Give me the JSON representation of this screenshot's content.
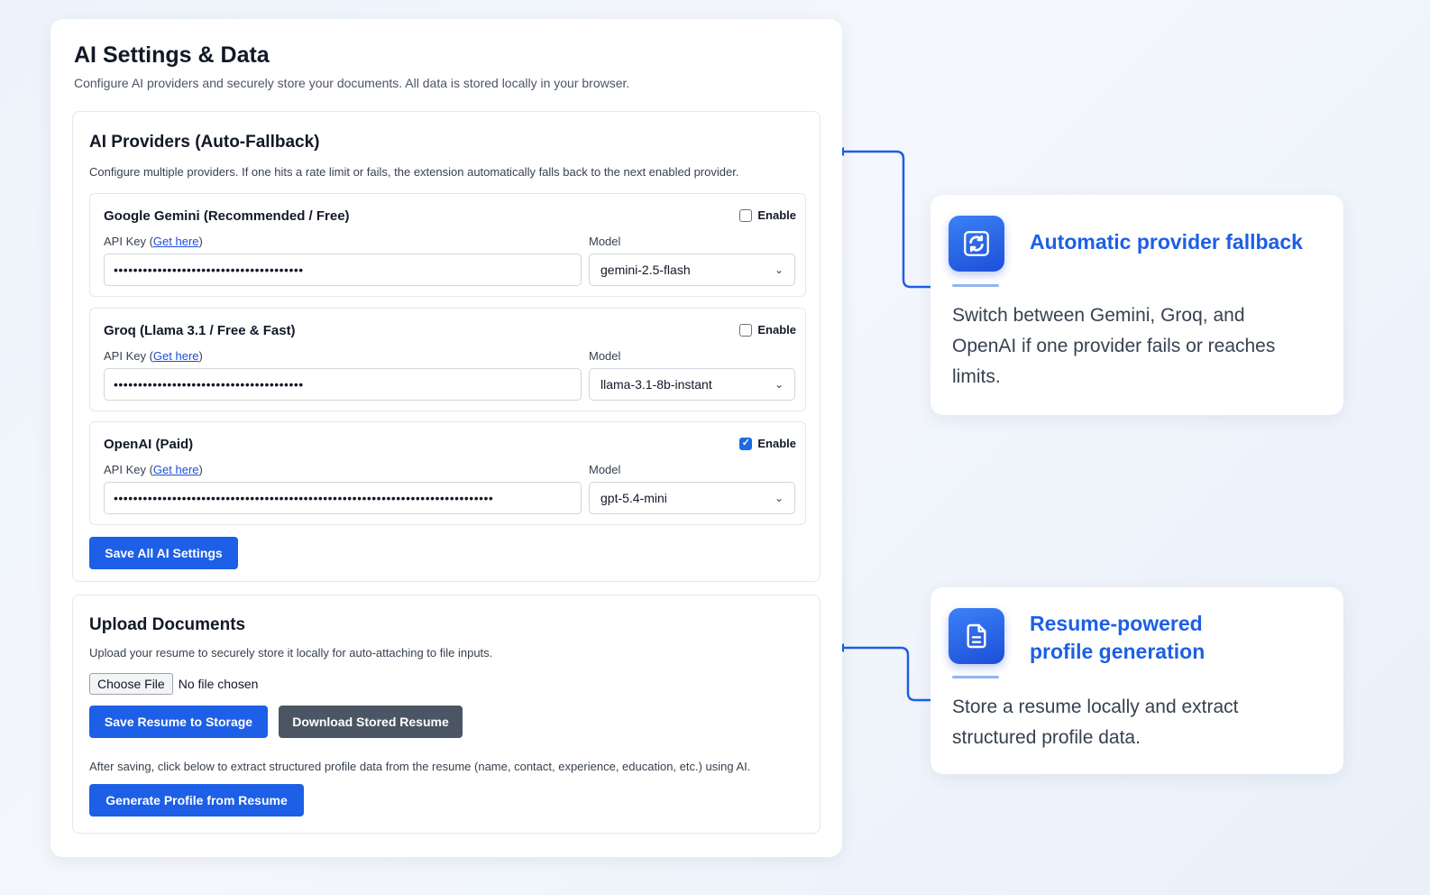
{
  "page": {
    "title": "AI Settings & Data",
    "subtitle": "Configure AI providers and securely store your documents. All data is stored locally in your browser."
  },
  "providers_section": {
    "title": "AI Providers (Auto-Fallback)",
    "description": "Configure multiple providers. If one hits a rate limit or fails, the extension automatically falls back to the next enabled provider.",
    "api_key_label": "API Key",
    "get_here_link": "Get here",
    "model_label": "Model",
    "enable_label": "Enable",
    "providers": [
      {
        "name": "Google Gemini (Recommended / Free)",
        "enabled": false,
        "api_key": "•••••••••••••••••••••••••••••••••••••••",
        "model": "gemini-2.5-flash"
      },
      {
        "name": "Groq (Llama 3.1 / Free & Fast)",
        "enabled": false,
        "api_key": "•••••••••••••••••••••••••••••••••••••••",
        "model": "llama-3.1-8b-instant"
      },
      {
        "name": "OpenAI (Paid)",
        "enabled": true,
        "api_key": "••••••••••••••••••••••••••••••••••••••••••••••••••••••••••••••••••••••••••••••",
        "model": "gpt-5.4-mini"
      }
    ],
    "save_button": "Save All AI Settings"
  },
  "upload_section": {
    "title": "Upload Documents",
    "description": "Upload your resume to securely store it locally for auto-attaching to file inputs.",
    "choose_file_button": "Choose File",
    "file_status": "No file chosen",
    "save_resume_button": "Save Resume to Storage",
    "download_resume_button": "Download Stored Resume",
    "extract_note": "After saving, click below to extract structured profile data from the resume (name, contact, experience, education, etc.) using AI.",
    "generate_button": "Generate Profile from Resume"
  },
  "callouts": [
    {
      "icon": "refresh-icon",
      "title": "Automatic provider fallback",
      "text": "Switch between Gemini, Groq, and OpenAI if one provider fails or reaches limits."
    },
    {
      "icon": "document-icon",
      "title": "Resume-powered profile generation",
      "text": "Store a resume locally and extract structured profile data."
    }
  ],
  "colors": {
    "accent": "#1d5fe6",
    "secondary_button": "#4b5563",
    "callout_title": "#1d5fe6"
  }
}
